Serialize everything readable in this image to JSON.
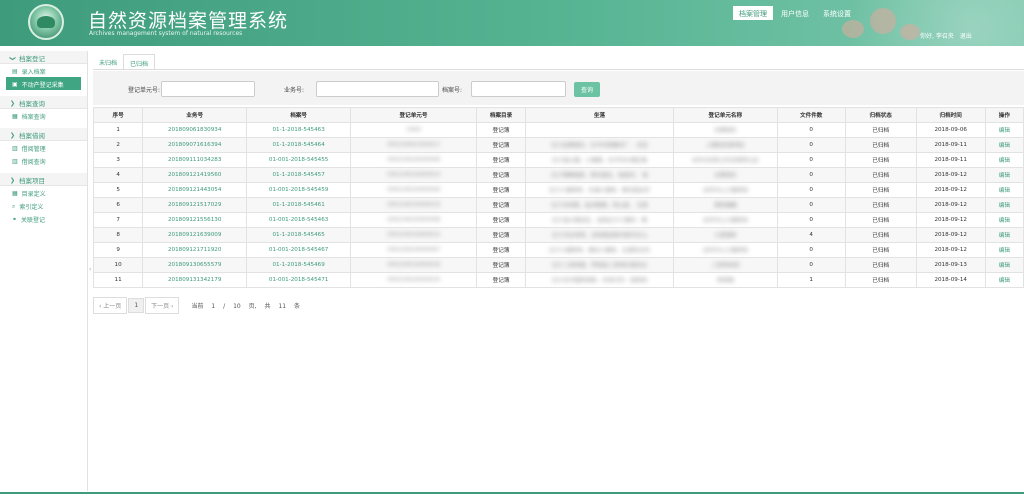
{
  "header": {
    "title_cn": "自然资源档案管理系统",
    "title_en": "Archives management system of natural resources",
    "nav": [
      {
        "label": "档案管理",
        "active": true
      },
      {
        "label": "用户信息",
        "active": false
      },
      {
        "label": "系统设置",
        "active": false
      }
    ],
    "user": {
      "greeting": "你好, 李召央",
      "logout": "退出"
    }
  },
  "sidebar": [
    {
      "type": "group",
      "label": "档案登记"
    },
    {
      "type": "item",
      "label": "录入档案",
      "icon": "upload-icon",
      "active": false
    },
    {
      "type": "item",
      "label": "不动产登记采集",
      "icon": "collect-icon",
      "active": true
    },
    {
      "type": "group",
      "label": "档案查询"
    },
    {
      "type": "item",
      "label": "档案查询",
      "icon": "search-list-icon",
      "active": false
    },
    {
      "type": "group",
      "label": "档案借阅"
    },
    {
      "type": "item",
      "label": "借阅管理",
      "icon": "list-icon",
      "active": false
    },
    {
      "type": "item",
      "label": "借阅查询",
      "icon": "list-icon",
      "active": false
    },
    {
      "type": "group",
      "label": "档案项目"
    },
    {
      "type": "item",
      "label": "目录定义",
      "icon": "grid-icon",
      "active": false
    },
    {
      "type": "item",
      "label": "索引定义",
      "icon": "search-icon",
      "active": false
    },
    {
      "type": "item",
      "label": "关联登记",
      "icon": "link-icon",
      "active": false
    }
  ],
  "tabs": [
    {
      "label": "未归档",
      "active": false
    },
    {
      "label": "已归档",
      "active": true
    }
  ],
  "filters": {
    "unit_no_label": "登记单元号:",
    "biz_no_label": "业务号:",
    "archive_no_label": "档案号:",
    "query_button": "查询"
  },
  "table": {
    "columns": [
      "序号",
      "业务号",
      "档案号",
      "登记单元号",
      "档案目录",
      "坐落",
      "登记单元名称",
      "文件件数",
      "归档状态",
      "归档时间",
      "操作"
    ],
    "rows": [
      [
        "1",
        "201809061830934",
        "01-1-2018-545463",
        "3300",
        "登记簿",
        "",
        "长期保存",
        "0",
        "已归档",
        "2018-09-06",
        "编辑"
      ],
      [
        "2",
        "201809071616394",
        "01-1-2018-545464",
        "330224001000017",
        "登记簿",
        "位于金華镇河、东平村南辙村厂、 后至",
        "上期民防事项区",
        "0",
        "已归档",
        "2018-09-11",
        "编辑"
      ],
      [
        "3",
        "201809111034283",
        "01-001-2018-545455",
        "330224010000006",
        "登记簿",
        "位于蓝山镇、小塘镇、东平村乡镇区路",
        "去年长庆防卫市决意转让区",
        "0",
        "已归档",
        "2018-09-11",
        "编辑"
      ],
      [
        "4",
        "201809121419560",
        "01-1-2018-545457",
        "330224010000014",
        "登记簿",
        "位于博寨镇遮、蒋村遗址、临县村、 临",
        "长期保存",
        "0",
        "已归档",
        "2018-09-12",
        "编辑"
      ],
      [
        "5",
        "201809121443054",
        "01-001-2018-545459",
        "330224010000009",
        "登记簿",
        "位于小镇林林、东浦小镇林、粮仓园支村",
        "去年中心小镇林场",
        "0",
        "已归档",
        "2018-09-12",
        "编辑"
      ],
      [
        "6",
        "201809121517029",
        "01-1-2018-545461",
        "330224010000019",
        "登记簿",
        "位于深圳镇、金泽管辖、西山县、 北部",
        "周新播播",
        "0",
        "已归档",
        "2018-09-12",
        "编辑"
      ],
      [
        "7",
        "201809121556130",
        "01-001-2018-545463",
        "330224010000008",
        "登记簿",
        "位于金沙镇深区、且陆位于小镇村、粮",
        "去年中心小镇林场",
        "0",
        "已归档",
        "2018-09-12",
        "编辑"
      ],
      [
        "8",
        "201809121639009",
        "01-1-2018-545465",
        "330224010000022",
        "登记簿",
        "位于东区林场、且陆周延新村临代东山",
        "九里镇林",
        "4",
        "已归档",
        "2018-09-12",
        "编辑"
      ],
      [
        "9",
        "201809121711920",
        "01-001-2018-545467",
        "330224010000007",
        "登记簿",
        "位于小镇林林、粮仓小镇林、北湖农业村",
        "去年中心小镇林场",
        "0",
        "已归档",
        "2018-09-12",
        "编辑"
      ],
      [
        "10",
        "201809130655579",
        "01-1-2018-545469",
        "330224010000018",
        "登记簿",
        "位于二西林镇、罗家县二西林红旗农业",
        "二西林林场",
        "0",
        "已归档",
        "2018-09-13",
        "编辑"
      ],
      [
        "11",
        "201809131342179",
        "01-001-2018-545471",
        "330224010000010",
        "登记簿",
        "位于名中国林场新、东林文件、临西则",
        "西林镇",
        "1",
        "已归档",
        "2018-09-14",
        "编辑"
      ]
    ]
  },
  "pager": {
    "prev": "‹ 上一页",
    "page": "1",
    "next": "下一页 ›",
    "current_label": "当前",
    "current": "1",
    "sep": "/",
    "total_pages": "10",
    "pages_unit": "页,",
    "total_label": "共",
    "total": "11",
    "total_unit": "条"
  }
}
